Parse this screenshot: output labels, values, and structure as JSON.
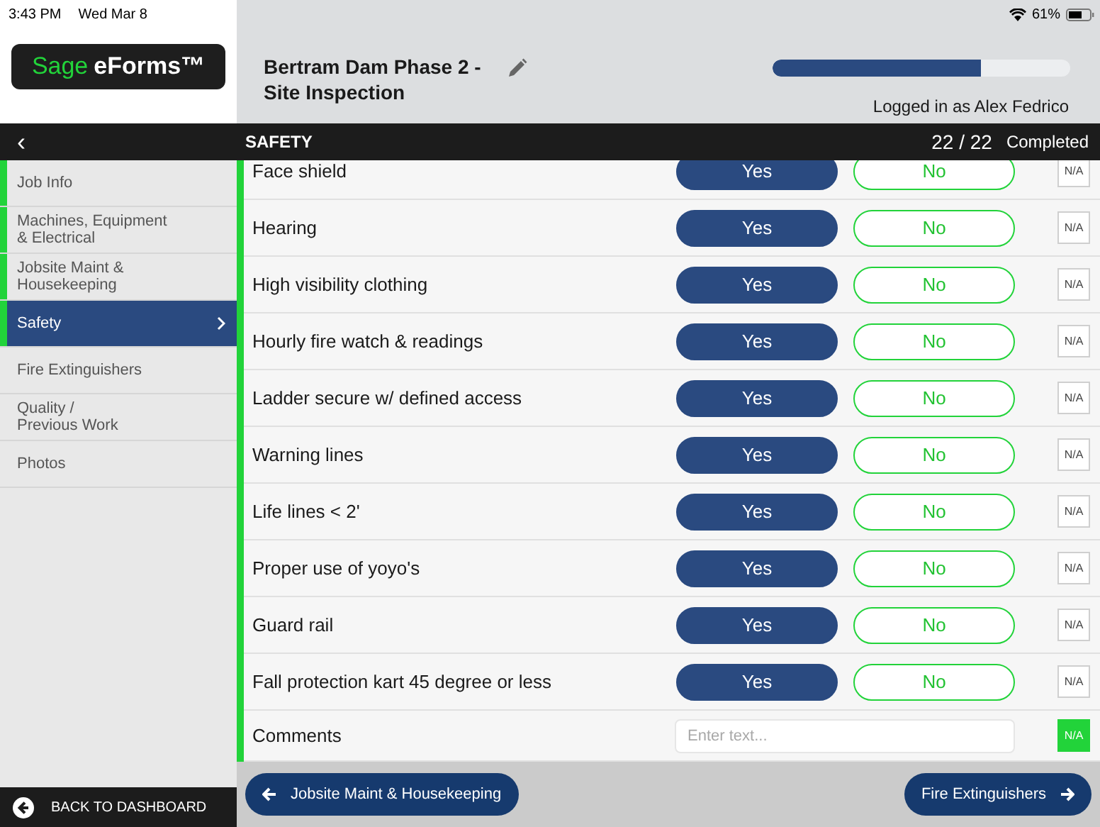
{
  "status_bar": {
    "time": "3:43 PM",
    "date": "Wed Mar 8",
    "battery": "61%"
  },
  "header": {
    "logo_brand": "Sage",
    "logo_product": "eForms™",
    "title": "Bertram Dam Phase 2 - Site Inspection",
    "progress": {
      "level": 0.7
    },
    "user": "Logged in as Alex Fedrico"
  },
  "section_bar": {
    "back": "‹",
    "title": "SAFETY",
    "count": "22 / 22",
    "status": "Completed"
  },
  "sidebar": {
    "items": [
      {
        "label": "Job Info",
        "selected": false,
        "completed": true
      },
      {
        "label": "Machines, Equipment\n& Electrical",
        "selected": false,
        "completed": true
      },
      {
        "label": "Jobsite Maint &\nHousekeeping",
        "selected": false,
        "completed": true
      },
      {
        "label": "Safety",
        "selected": true,
        "completed": true
      },
      {
        "label": "Fire Extinguishers",
        "selected": false,
        "completed": false
      },
      {
        "label": "Quality /\nPrevious Work",
        "selected": false,
        "completed": false
      },
      {
        "label": "Photos",
        "selected": false,
        "completed": false
      }
    ],
    "back_button": "BACK TO DASHBOARD"
  },
  "questions": [
    {
      "kind": "choice",
      "label": "Face shield",
      "options": [
        {
          "label": "Yes",
          "selected": true
        },
        {
          "label": "No",
          "selected": false
        }
      ],
      "na": {
        "label": "N/A",
        "selected": false
      }
    },
    {
      "kind": "choice",
      "label": "Hearing",
      "options": [
        {
          "label": "Yes",
          "selected": true
        },
        {
          "label": "No",
          "selected": false
        }
      ],
      "na": {
        "label": "N/A",
        "selected": false
      }
    },
    {
      "kind": "choice",
      "label": "High visibility clothing",
      "options": [
        {
          "label": "Yes",
          "selected": true
        },
        {
          "label": "No",
          "selected": false
        }
      ],
      "na": {
        "label": "N/A",
        "selected": false
      }
    },
    {
      "kind": "choice",
      "label": "Hourly fire watch & readings",
      "options": [
        {
          "label": "Yes",
          "selected": true
        },
        {
          "label": "No",
          "selected": false
        }
      ],
      "na": {
        "label": "N/A",
        "selected": false
      }
    },
    {
      "kind": "choice",
      "label": "Ladder secure w/ defined access",
      "options": [
        {
          "label": "Yes",
          "selected": true
        },
        {
          "label": "No",
          "selected": false
        }
      ],
      "na": {
        "label": "N/A",
        "selected": false
      }
    },
    {
      "kind": "choice",
      "label": "Warning lines",
      "options": [
        {
          "label": "Yes",
          "selected": true
        },
        {
          "label": "No",
          "selected": false
        }
      ],
      "na": {
        "label": "N/A",
        "selected": false
      }
    },
    {
      "kind": "choice",
      "label": "Life lines < 2'",
      "options": [
        {
          "label": "Yes",
          "selected": true
        },
        {
          "label": "No",
          "selected": false
        }
      ],
      "na": {
        "label": "N/A",
        "selected": false
      }
    },
    {
      "kind": "choice",
      "label": "Proper use of yoyo's",
      "options": [
        {
          "label": "Yes",
          "selected": true
        },
        {
          "label": "No",
          "selected": false
        }
      ],
      "na": {
        "label": "N/A",
        "selected": false
      }
    },
    {
      "kind": "choice",
      "label": "Guard rail",
      "options": [
        {
          "label": "Yes",
          "selected": true
        },
        {
          "label": "No",
          "selected": false
        }
      ],
      "na": {
        "label": "N/A",
        "selected": false
      }
    },
    {
      "kind": "choice",
      "label": "Fall protection kart 45 degree or less",
      "options": [
        {
          "label": "Yes",
          "selected": true
        },
        {
          "label": "No",
          "selected": false
        }
      ],
      "na": {
        "label": "N/A",
        "selected": false
      }
    },
    {
      "kind": "text",
      "label": "Comments",
      "placeholder": "Enter text...",
      "na": {
        "label": "N/A",
        "selected": true
      }
    }
  ],
  "footer": {
    "prev": "Jobsite Maint & Housekeeping",
    "next": "Fire Extinguishers"
  }
}
